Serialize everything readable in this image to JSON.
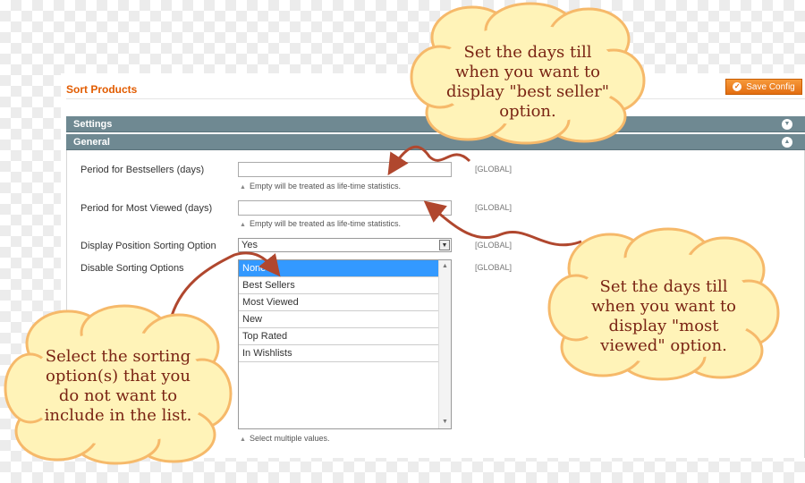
{
  "page": {
    "title": "Sort Products",
    "save_button": "Save Config"
  },
  "sections": {
    "settings": "Settings",
    "general": "General"
  },
  "fields": {
    "bestsellers": {
      "label": "Period for Bestsellers (days)",
      "value": "",
      "note": "Empty will be treated as life-time statistics.",
      "scope": "[GLOBAL]"
    },
    "most_viewed": {
      "label": "Period for Most Viewed (days)",
      "value": "",
      "note": "Empty will be treated as life-time statistics.",
      "scope": "[GLOBAL]"
    },
    "display_position": {
      "label": "Display Position Sorting Option",
      "value": "Yes",
      "scope": "[GLOBAL]"
    },
    "disable_sorting": {
      "label": "Disable Sorting Options",
      "scope": "[GLOBAL]",
      "options": [
        "None",
        "Best Sellers",
        "Most Viewed",
        "New",
        "Top Rated",
        "In Wishlists"
      ],
      "selected": "None",
      "note": "Select multiple values."
    }
  },
  "callouts": {
    "best_seller": [
      "Set the days till",
      "when you want to",
      "display \"best seller\"",
      "option."
    ],
    "most_viewed": [
      "Set the days till",
      "when you want to",
      "display \"most",
      "viewed\" option."
    ],
    "sorting": [
      "Select the sorting",
      "option(s) that you",
      "do not want to",
      "include in the list."
    ]
  },
  "colors": {
    "accent": "#e25c00",
    "section_header": "#6f8992",
    "selected_option": "#3399ff",
    "callout_fill": "#fff3b8",
    "callout_edge": "#f6b96a",
    "callout_text": "#7a2414",
    "arrow": "#b0472e"
  }
}
